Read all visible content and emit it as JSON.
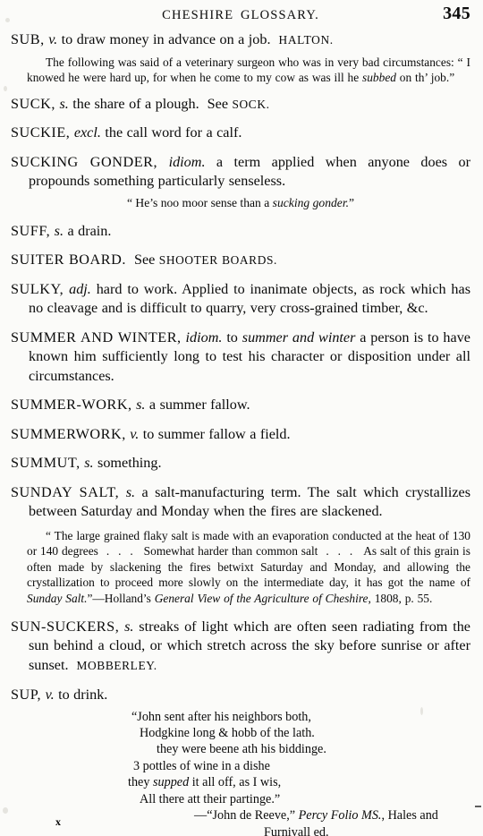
{
  "page": {
    "running_head": "CHESHIRE GLOSSARY.",
    "folio": "345",
    "signature_mark": "x"
  },
  "entries": [
    {
      "id": "sub",
      "headword": "SUB,",
      "pos": "v.",
      "definition": " to draw money in advance on a job.",
      "locality": "HALTON.",
      "quote": "The following was said of a veterinary surgeon who was in very bad circumstances: “ I knowed he were hard up, for when he come to my cow as was ill he subbed on th’ job.”",
      "quote_parts": {
        "before_italic": "The following was said of a veterinary surgeon who was in very bad circumstances: “ I knowed he were hard up, for when he come to my cow as was ill he ",
        "italic": "subbed",
        "after_italic": " on th’ job.”"
      }
    },
    {
      "id": "suck",
      "headword": "SUCK,",
      "pos": "s.",
      "definition": " the share of a plough.",
      "cross_ref_lead": "See ",
      "cross_ref": "SOCK."
    },
    {
      "id": "suckie",
      "headword": "SUCKIE,",
      "pos": "excl.",
      "definition": " the call word for a calf."
    },
    {
      "id": "sucking-gonder",
      "headword": "SUCKING  GONDER,",
      "pos": "idiom.",
      "definition": " a term applied when anyone does or propounds something particularly senseless.",
      "quote_parts": {
        "before_italic": "“ He’s noo moor sense than a ",
        "italic": "sucking gonder.",
        "after_italic": "”"
      }
    },
    {
      "id": "suff",
      "headword": "SUFF,",
      "pos": "s.",
      "definition": " a drain."
    },
    {
      "id": "suiter-board",
      "headword": "SUITER BOARD.",
      "cross_ref_lead": "See ",
      "cross_ref": "SHOOTER BOARDS."
    },
    {
      "id": "sulky",
      "headword": "SULKY,",
      "pos": "adj.",
      "definition": " hard to work.  Applied to inanimate objects, as rock which has no cleavage and is difficult to quarry, very cross-grained timber, &c."
    },
    {
      "id": "summer-and-winter",
      "headword": "SUMMER AND WINTER,",
      "pos": "idiom.",
      "definition_parts": {
        "before_italic": " to ",
        "italic": "summer and winter",
        "after_italic": " a person is to have known him sufficiently long to test his character or disposition under all circumstances."
      }
    },
    {
      "id": "summer-work",
      "headword": "SUMMER-WORK,",
      "pos": "s.",
      "definition": " a summer fallow."
    },
    {
      "id": "summerwork",
      "headword": "SUMMERWORK,",
      "pos": "v.",
      "definition": " to summer fallow a field."
    },
    {
      "id": "summut",
      "headword": "SUMMUT,",
      "pos": "s.",
      "definition": " something."
    },
    {
      "id": "sunday-salt",
      "headword": "SUNDAY SALT,",
      "pos": "s.",
      "definition": " a salt-manufacturing term.  The salt which crystallizes between Saturday and Monday when the fires are slackened.",
      "citation": {
        "line1": "“ The large grained flaky salt is made with an evaporation conducted at the heat of 130 or 140 degrees",
        "ellipsis1": ".  .  .",
        "line2": "Somewhat harder than common salt",
        "ellipsis2": ".  .  .",
        "line3": "As salt of this grain is often made by slackening the fires betwixt Saturday and Monday, and allowing the crystallization to proceed more slowly on the intermediate day, it has got the name of ",
        "italic_term": "Sunday Salt.",
        "after_term": "”—",
        "source_author": "Holland’s ",
        "source_title": "General View of the Agriculture of Cheshire",
        "source_rest": ", 1808, p. 55."
      }
    },
    {
      "id": "sun-suckers",
      "headword": "SUN-SUCKERS,",
      "pos": "s.",
      "definition": " streaks of light which are often seen radiating from the sun behind a cloud, or which stretch across the sky before sunrise or after sunset.",
      "locality": "MOBBERLEY."
    },
    {
      "id": "sup",
      "headword": "SUP,",
      "pos": "v.",
      "definition": " to drink.",
      "verse": {
        "lines": [
          {
            "indent": 2,
            "text": "“John sent after his neighbors both,"
          },
          {
            "indent": 3,
            "text": "Hodgkine long & hobb of the lath."
          },
          {
            "indent": 6,
            "text": "they were beene ath his biddinge."
          },
          {
            "indent": 2,
            "text": "3 pottles of wine in a dishe"
          },
          {
            "indent": 1,
            "text": "they supped it all off, as I wis,"
          },
          {
            "indent": 3,
            "text": "All there att their partinge.”"
          }
        ],
        "italic_word": "supped",
        "attribution_line1_lead": "—“John de Reeve,” ",
        "attribution_title": "Percy Folio MS.",
        "attribution_line1_tail": ", Hales and",
        "attribution_line2": "Furnivall ed."
      }
    }
  ]
}
